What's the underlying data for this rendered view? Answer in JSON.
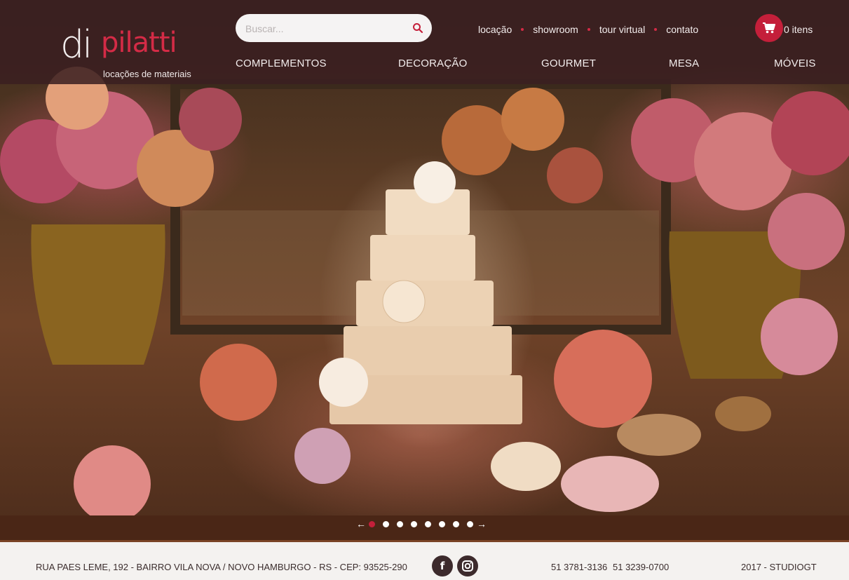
{
  "brand": {
    "logo_di": "di",
    "logo_name": "pilatti",
    "tagline": "locações de materiais",
    "colors": {
      "accent": "#d42b46",
      "header_bg": "#3a1e21",
      "footer_bg": "#f4f2f0"
    }
  },
  "search": {
    "placeholder": "Buscar...",
    "icon": "search-icon"
  },
  "top_links": [
    "locação",
    "showroom",
    "tour virtual",
    "contato"
  ],
  "cart": {
    "icon": "cart-icon",
    "count_label": "0 itens"
  },
  "nav": [
    "COMPLEMENTOS",
    "DECORAÇÃO",
    "GOURMET",
    "MESA",
    "MÓVEIS"
  ],
  "slider": {
    "total_slides": 8,
    "active_index": 0,
    "prev_icon": "arrow-left-icon",
    "next_icon": "arrow-right-icon"
  },
  "footer": {
    "address": "RUA PAES LEME, 192 - BAIRRO VILA NOVA / NOVO HAMBURGO - RS - CEP: 93525-290",
    "social": [
      {
        "icon": "facebook-icon",
        "glyph": "f"
      },
      {
        "icon": "instagram-icon"
      }
    ],
    "phone_1": "51 3781-3136",
    "phone_2": "51 3239-0700",
    "credit": "2017 - STUDIOGT"
  }
}
